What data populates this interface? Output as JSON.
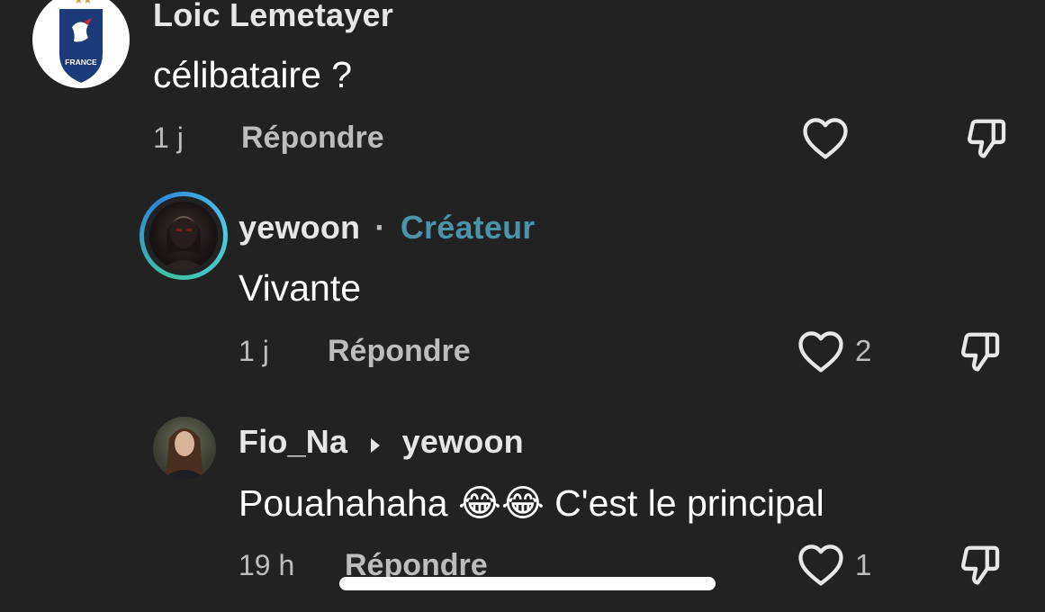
{
  "comments": [
    {
      "author": "Loic Lemetayer",
      "text": "célibataire ?",
      "time": "1 j",
      "reply_label": "Répondre",
      "like_count": "",
      "avatar": "france-fff-crest"
    },
    {
      "author": "yewoon",
      "separator": "·",
      "badge": "Créateur",
      "text": "Vivante",
      "time": "1 j",
      "reply_label": "Répondre",
      "like_count": "2",
      "avatar": "creator-avatar-with-story-ring"
    },
    {
      "author": "Fio_Na",
      "reply_to": "yewoon",
      "text": "Pouahahaha 😂😂 C'est le principal",
      "time": "19 h",
      "reply_label": "Répondre",
      "like_count": "1",
      "avatar": "user-avatar-photo"
    }
  ],
  "crest_text": "FRANCE",
  "colors": {
    "background": "#222222",
    "creator_badge": "#4a93a8",
    "secondary_text": "#bdbdbd"
  },
  "icons": [
    "heart-outline-icon",
    "thumbs-down-icon",
    "reply-arrow-icon"
  ]
}
